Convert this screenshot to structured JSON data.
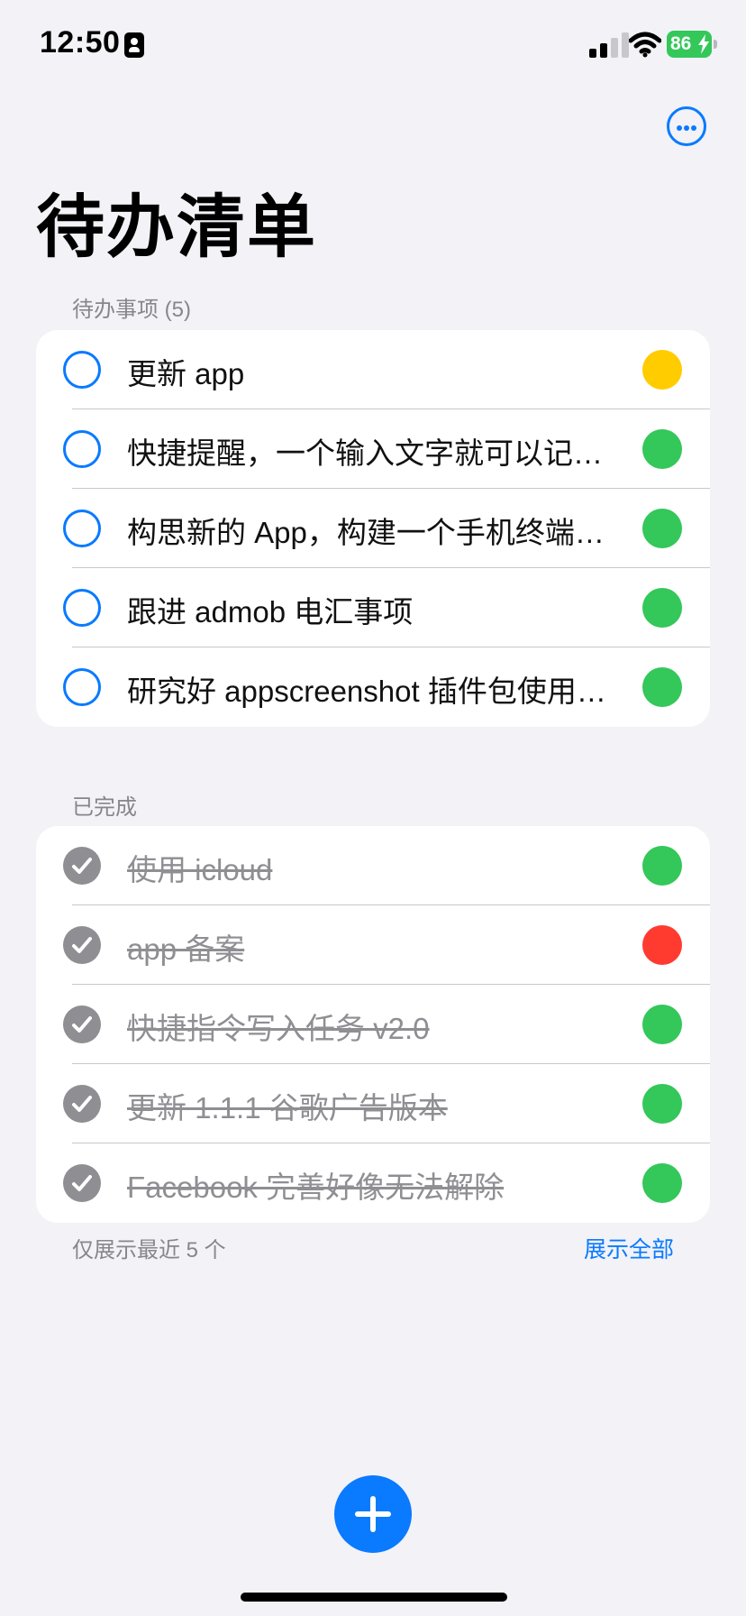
{
  "status_bar": {
    "time": "12:50",
    "battery_percent": "86",
    "focus_icon": "person-badge-icon",
    "signal_icon": "cellular-signal-icon",
    "wifi_icon": "wifi-icon",
    "battery_icon": "battery-charging-icon"
  },
  "header": {
    "title": "待办清单",
    "more_icon": "ellipsis-circle-icon"
  },
  "pending": {
    "header": "待办事项 (5)",
    "items": [
      {
        "text": "更新 app",
        "priority_color": "#ffcc00"
      },
      {
        "text": "快捷提醒，一个输入文字就可以记录待办的应用",
        "priority_color": "#34c759"
      },
      {
        "text": "构思新的 App，构建一个手机终端应用",
        "priority_color": "#34c759"
      },
      {
        "text": "跟进 admob 电汇事项",
        "priority_color": "#34c759"
      },
      {
        "text": "研究好 appscreenshot 插件包使用方法",
        "priority_color": "#34c759"
      }
    ]
  },
  "completed": {
    "header": "已完成",
    "items": [
      {
        "text": "使用 icloud",
        "priority_color": "#34c759"
      },
      {
        "text": "app 备案",
        "priority_color": "#ff3b30"
      },
      {
        "text": "快捷指令写入任务 v2.0",
        "priority_color": "#34c759"
      },
      {
        "text": "更新 1.1.1 谷歌广告版本",
        "priority_color": "#34c759"
      },
      {
        "text": "Facebook 完善好像无法解除",
        "priority_color": "#34c759"
      }
    ],
    "footer_note": "仅展示最近 5 个",
    "show_all_label": "展示全部"
  },
  "add_button": {
    "icon": "plus-icon"
  },
  "colors": {
    "accent": "#0a7aff",
    "completed_check": "#8e8e93",
    "background": "#f2f2f7"
  }
}
